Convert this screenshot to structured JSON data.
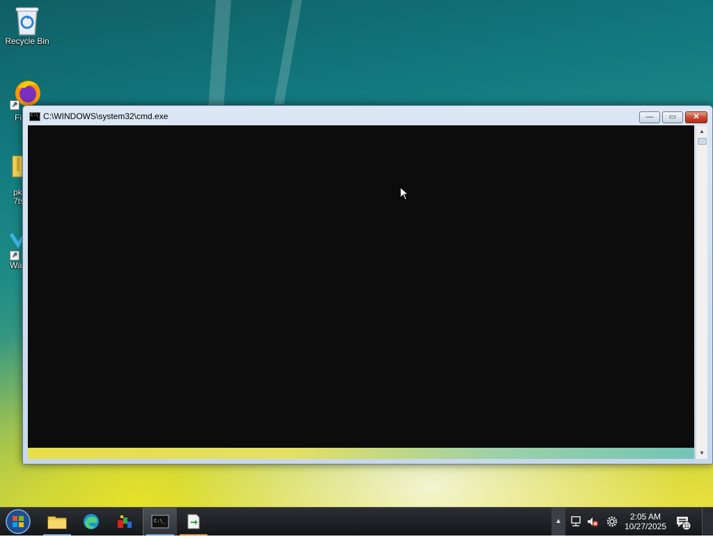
{
  "desktop": {
    "icons": [
      {
        "id": "recycle-bin",
        "label": "Recycle Bin",
        "icon": "recycle-bin-icon"
      },
      {
        "id": "firefox",
        "label": "Fi",
        "icon": "firefox-icon"
      },
      {
        "id": "pk-file",
        "label": "pk 7ts",
        "icon": "archive-file-icon"
      },
      {
        "id": "wa",
        "label": "Wa",
        "icon": "app-shortcut-icon"
      }
    ]
  },
  "window": {
    "title": "C:\\WINDOWS\\system32\\cmd.exe",
    "app_icon_text": "C:\\_",
    "minimize_glyph": "—",
    "maximize_glyph": "▭",
    "close_glyph": "✕"
  },
  "taskbar": {
    "start_icon": "windows-start-orb",
    "pinned": [
      {
        "name": "file-explorer",
        "icon": "folder-icon",
        "active": false
      },
      {
        "name": "edge",
        "icon": "edge-icon",
        "active": false
      },
      {
        "name": "paint-like-app",
        "icon": "app-icon",
        "active": false
      },
      {
        "name": "command-prompt",
        "icon": "cmd-icon",
        "active": true
      },
      {
        "name": "document-app",
        "icon": "document-icon",
        "active": false
      }
    ],
    "tray": {
      "show_hidden_glyph": "▲",
      "network_icon": "network-icon",
      "volume_icon": "volume-muted-icon",
      "settings_icon": "gear-icon",
      "time": "2:05 AM",
      "date": "10/27/2025",
      "notification_count": "11"
    }
  },
  "colors": {
    "console_bg": "#0c0c0c",
    "close_button": "#c9442a",
    "taskbar": "#1e2024"
  }
}
